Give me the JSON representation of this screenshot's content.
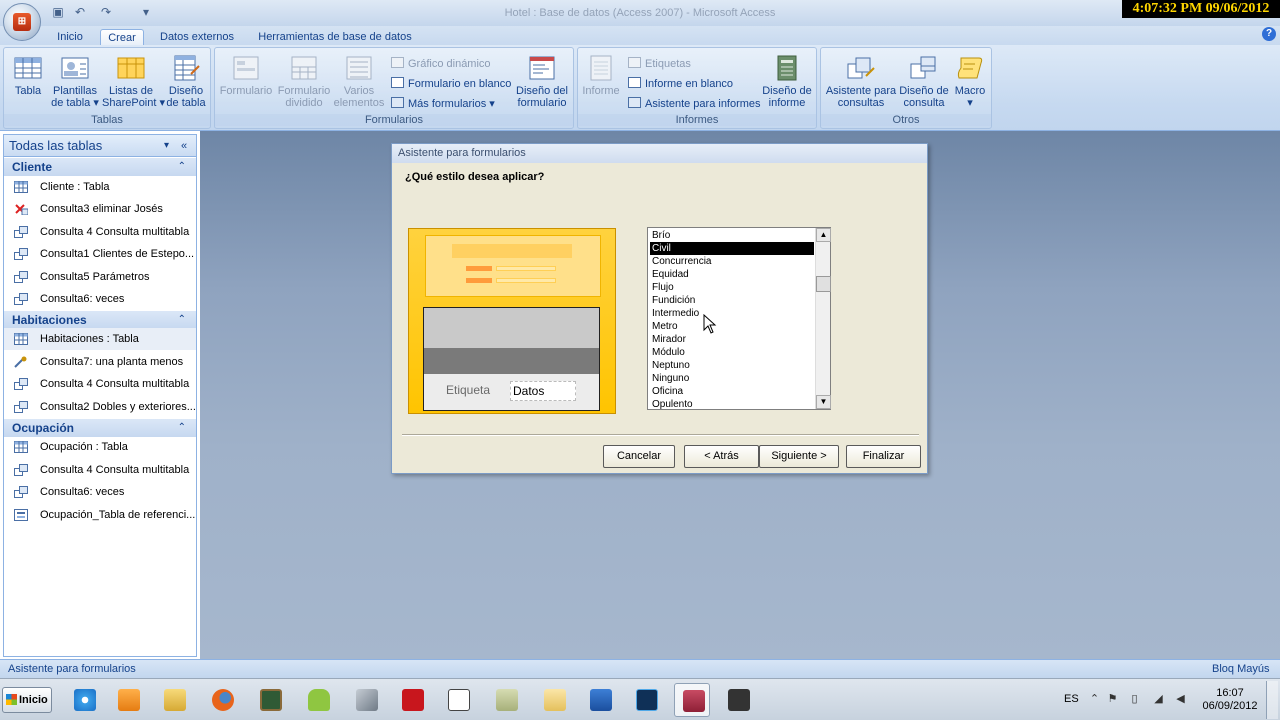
{
  "window": {
    "title": "Hotel : Base de datos (Access 2007) - Microsoft Access",
    "clock": "4:07:32 PM 09/06/2012"
  },
  "tabs": [
    {
      "label": "Inicio"
    },
    {
      "label": "Crear"
    },
    {
      "label": "Datos externos"
    },
    {
      "label": "Herramientas de base de datos"
    }
  ],
  "ribbon": {
    "tablas": {
      "label": "Tablas",
      "buttons": [
        "Tabla",
        "Plantillas\nde tabla ▾",
        "Listas de\nSharePoint ▾",
        "Diseño\nde tabla"
      ]
    },
    "formularios": {
      "label": "Formularios",
      "buttons": [
        "Formulario",
        "Formulario\ndividido",
        "Varios\nelementos"
      ],
      "small": [
        "Gráfico dinámico",
        "Formulario en blanco",
        "Más formularios ▾"
      ],
      "big": "Diseño del\nformulario"
    },
    "informes": {
      "label": "Informes",
      "buttons": [
        "Informe"
      ],
      "small": [
        "Etiquetas",
        "Informe en blanco",
        "Asistente para informes"
      ],
      "big": "Diseño de\ninforme"
    },
    "otros": {
      "label": "Otros",
      "buttons": [
        "Asistente para\nconsultas",
        "Diseño de\nconsulta",
        "Macro\n▾"
      ]
    }
  },
  "nav": {
    "header": "Todas las tablas",
    "sections": [
      {
        "title": "Cliente",
        "items": [
          "Cliente : Tabla",
          "Consulta3 eliminar Josés",
          "Consulta 4 Consulta multitabla",
          "Consulta1 Clientes de Estepo...",
          "Consulta5 Parámetros",
          "Consulta6: veces"
        ]
      },
      {
        "title": "Habitaciones",
        "items": [
          "Habitaciones : Tabla",
          "Consulta7: una planta menos",
          "Consulta 4 Consulta multitabla",
          "Consulta2 Dobles y exteriores..."
        ]
      },
      {
        "title": "Ocupación",
        "items": [
          "Ocupación : Tabla",
          "Consulta 4 Consulta multitabla",
          "Consulta6: veces",
          "Ocupación_Tabla de referenci..."
        ]
      }
    ]
  },
  "dialog": {
    "title": "Asistente para formularios",
    "question": "¿Qué estilo desea aplicar?",
    "preview": {
      "label": "Etiqueta",
      "data": "Datos"
    },
    "styles": [
      "Brío",
      "Civil",
      "Concurrencia",
      "Equidad",
      "Flujo",
      "Fundición",
      "Intermedio",
      "Metro",
      "Mirador",
      "Módulo",
      "Neptuno",
      "Ninguno",
      "Oficina",
      "Opulento"
    ],
    "selected_style": "Civil",
    "buttons": {
      "cancel": "Cancelar",
      "back": "< Atrás",
      "next": "Siguiente >",
      "finish": "Finalizar"
    }
  },
  "status": {
    "left": "Asistente para formularios",
    "right": "Bloq Mayús"
  },
  "taskbar": {
    "start": "Inicio",
    "lang": "ES",
    "time": "16:07",
    "date": "06/09/2012"
  },
  "colors": {
    "accent": "#15428b",
    "ribbon": "#c6d9f0",
    "preview": "#ffc400",
    "workspace": "#8fa3bf"
  }
}
